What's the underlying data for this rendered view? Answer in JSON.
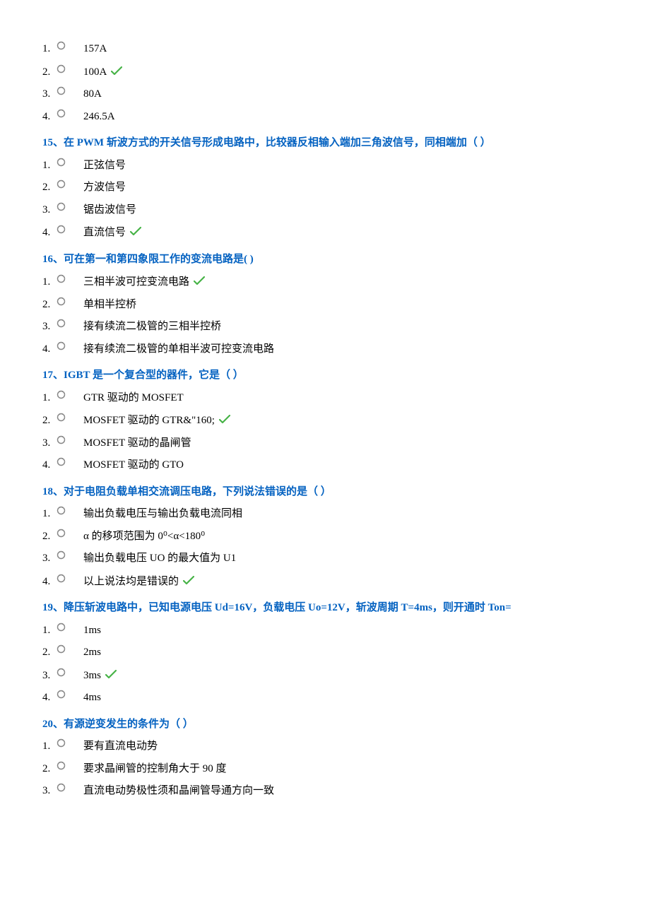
{
  "orphan_options": {
    "items": [
      {
        "num": "1.",
        "text": "157A",
        "correct": false
      },
      {
        "num": "2.",
        "text": "100A",
        "correct": true
      },
      {
        "num": "3.",
        "text": "80A",
        "correct": false
      },
      {
        "num": "4.",
        "text": "246.5A",
        "correct": false
      }
    ]
  },
  "questions": [
    {
      "title": "15、在 PWM 斩波方式的开关信号形成电路中，比较器反相输入端加三角波信号，同相端加（  ）",
      "items": [
        {
          "num": "1.",
          "text": "正弦信号",
          "correct": false
        },
        {
          "num": "2.",
          "text": "方波信号",
          "correct": false
        },
        {
          "num": "3.",
          "text": "锯齿波信号",
          "correct": false
        },
        {
          "num": "4.",
          "text": "直流信号",
          "correct": true
        }
      ]
    },
    {
      "title": "16、可在第一和第四象限工作的变流电路是(    )",
      "items": [
        {
          "num": "1.",
          "text": "三相半波可控变流电路",
          "correct": true
        },
        {
          "num": "2.",
          "text": "单相半控桥",
          "correct": false
        },
        {
          "num": "3.",
          "text": "接有续流二极管的三相半控桥",
          "correct": false
        },
        {
          "num": "4.",
          "text": "接有续流二极管的单相半波可控变流电路",
          "correct": false
        }
      ]
    },
    {
      "title": "17、IGBT 是一个复合型的器件，它是（   ）",
      "items": [
        {
          "num": "1.",
          "text": "GTR 驱动的 MOSFET",
          "correct": false
        },
        {
          "num": "2.",
          "text": "MOSFET 驱动的 GTR&\"160;",
          "correct": true
        },
        {
          "num": "3.",
          "text": "MOSFET 驱动的晶闸管",
          "correct": false
        },
        {
          "num": "4.",
          "text": "MOSFET 驱动的 GTO",
          "correct": false
        }
      ]
    },
    {
      "title": "18、对于电阻负载单相交流调压电路，下列说法错误的是（  ）",
      "items": [
        {
          "num": "1.",
          "text": "输出负载电压与输出负载电流同相",
          "correct": false
        },
        {
          "num": "2.",
          "text": "α 的移项范围为 0⁰<α<180⁰",
          "correct": false
        },
        {
          "num": "3.",
          "text": "输出负载电压 UO 的最大值为 U1",
          "correct": false
        },
        {
          "num": "4.",
          "text": "以上说法均是错误的",
          "correct": true
        }
      ]
    },
    {
      "title": "19、降压斩波电路中，已知电源电压 Ud=16V，负载电压 Uo=12V，斩波周期 T=4ms，则开通时 Ton=",
      "items": [
        {
          "num": "1.",
          "text": "1ms",
          "correct": false
        },
        {
          "num": "2.",
          "text": "2ms",
          "correct": false
        },
        {
          "num": "3.",
          "text": "3ms",
          "correct": true
        },
        {
          "num": "4.",
          "text": "4ms",
          "correct": false
        }
      ]
    },
    {
      "title": "20、有源逆变发生的条件为（  ）",
      "items": [
        {
          "num": "1.",
          "text": "要有直流电动势",
          "correct": false
        },
        {
          "num": "2.",
          "text": "要求晶闸管的控制角大于 90 度",
          "correct": false
        },
        {
          "num": "3.",
          "text": "直流电动势极性须和晶闸管导通方向一致",
          "correct": false
        }
      ]
    }
  ]
}
